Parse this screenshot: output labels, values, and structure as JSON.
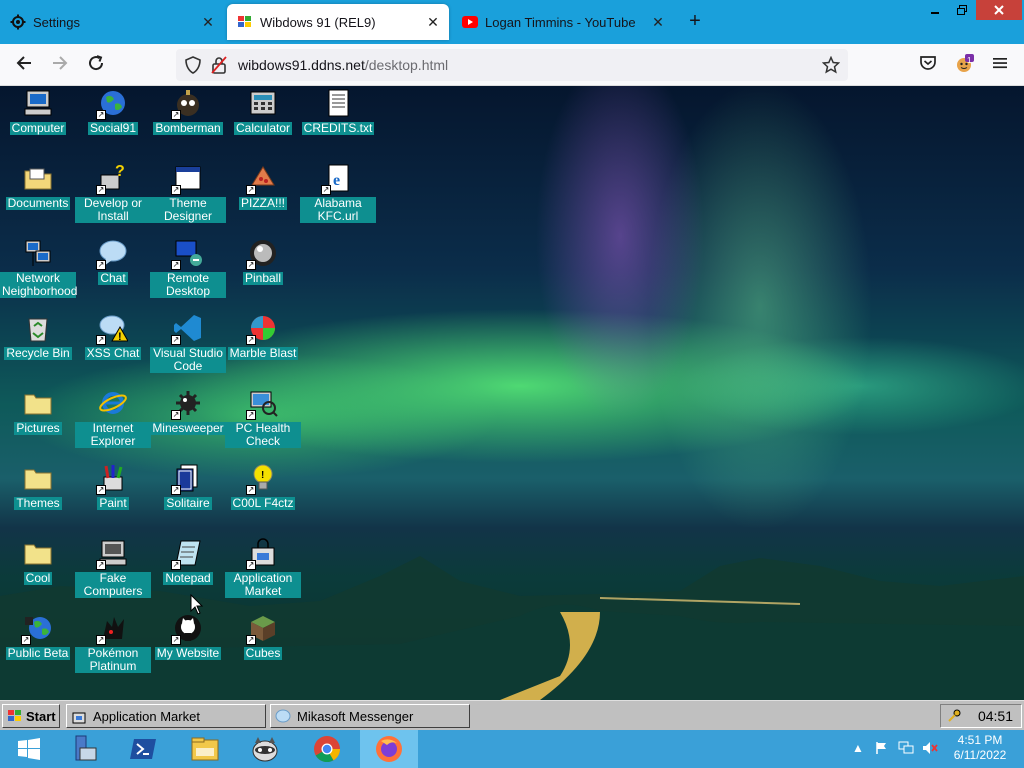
{
  "browser": {
    "tabs": [
      {
        "title": "Settings",
        "icon": "gear-icon",
        "active": false
      },
      {
        "title": "Wibdows 91 (REL9)",
        "icon": "wibdows-icon",
        "active": true
      },
      {
        "title": "Logan Timmins - YouTube",
        "icon": "youtube-icon",
        "active": false
      }
    ],
    "url": {
      "host": "wibdows91.ddns.net",
      "path": "/desktop.html"
    },
    "profile_badge": "1"
  },
  "desktop": {
    "icons": [
      {
        "label": "Computer",
        "shortcut": false
      },
      {
        "label": "Social91",
        "shortcut": true
      },
      {
        "label": "Bomberman",
        "shortcut": true
      },
      {
        "label": "Calculator",
        "shortcut": false
      },
      {
        "label": "CREDITS.txt",
        "shortcut": false
      },
      {
        "label": "Documents",
        "shortcut": false
      },
      {
        "label": "Develop or Install",
        "shortcut": true
      },
      {
        "label": "Theme Designer",
        "shortcut": true
      },
      {
        "label": "PIZZA!!!",
        "shortcut": true
      },
      {
        "label": "Alabama KFC.url",
        "shortcut": true
      },
      {
        "label": "Network Neighborhood",
        "shortcut": false
      },
      {
        "label": "Chat",
        "shortcut": true
      },
      {
        "label": "Remote Desktop",
        "shortcut": true
      },
      {
        "label": "Pinball",
        "shortcut": true
      },
      {
        "label": "Recycle Bin",
        "shortcut": false
      },
      {
        "label": "XSS Chat",
        "shortcut": true
      },
      {
        "label": "Visual Studio Code",
        "shortcut": true
      },
      {
        "label": "Marble Blast",
        "shortcut": true
      },
      {
        "label": "Pictures",
        "shortcut": false
      },
      {
        "label": "Internet Explorer",
        "shortcut": false
      },
      {
        "label": "Minesweeper",
        "shortcut": true
      },
      {
        "label": "PC Health Check",
        "shortcut": true
      },
      {
        "label": "Themes",
        "shortcut": false
      },
      {
        "label": "Paint",
        "shortcut": true
      },
      {
        "label": "Solitaire",
        "shortcut": true
      },
      {
        "label": "C00L F4ctz",
        "shortcut": true
      },
      {
        "label": "Cool",
        "shortcut": false
      },
      {
        "label": "Fake Computers",
        "shortcut": true
      },
      {
        "label": "Notepad",
        "shortcut": true
      },
      {
        "label": "Application Market",
        "shortcut": true
      },
      {
        "label": "Public Beta",
        "shortcut": true
      },
      {
        "label": "Pokémon Platinum",
        "shortcut": true
      },
      {
        "label": "My Website",
        "shortcut": true
      },
      {
        "label": "Cubes",
        "shortcut": true
      }
    ]
  },
  "w95_taskbar": {
    "start_label": "Start",
    "windows": [
      {
        "label": "Application Market"
      },
      {
        "label": "Mikasoft Messenger"
      }
    ],
    "clock": "04:51"
  },
  "os_taskbar": {
    "time": "4:51 PM",
    "date": "6/11/2022"
  },
  "colors": {
    "tabbar": "#1aa0db",
    "taskbar": "#3aa0d8",
    "icon_label_bg": "#0e8f90"
  }
}
